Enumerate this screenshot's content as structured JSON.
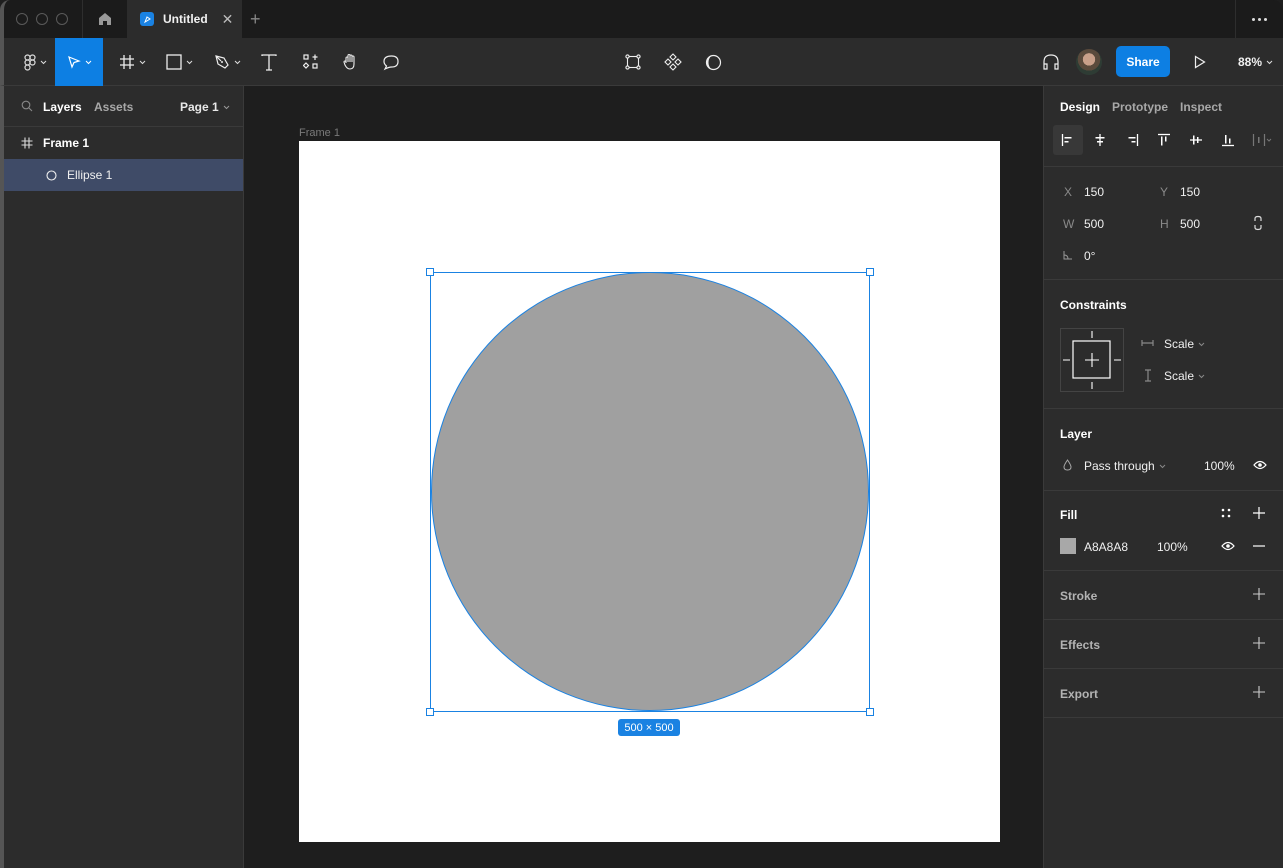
{
  "titlebar": {
    "tab_title": "Untitled",
    "home_icon": "home-icon",
    "close_icon": "close-icon",
    "add_tab_icon": "plus-icon",
    "more_icon": "more-icon"
  },
  "toolbar": {
    "tools": [
      {
        "name": "main-menu",
        "icon": "figma-logo-icon",
        "has_dropdown": true
      },
      {
        "name": "move-tool",
        "icon": "cursor-icon",
        "has_dropdown": true,
        "active": true
      },
      {
        "name": "frame-tool",
        "icon": "frame-icon",
        "has_dropdown": true
      },
      {
        "name": "shape-tool",
        "icon": "rectangle-icon",
        "has_dropdown": true
      },
      {
        "name": "pen-tool",
        "icon": "pen-icon",
        "has_dropdown": true
      },
      {
        "name": "text-tool",
        "icon": "text-icon"
      },
      {
        "name": "resources-tool",
        "icon": "resources-icon"
      },
      {
        "name": "hand-tool",
        "icon": "hand-icon"
      },
      {
        "name": "comment-tool",
        "icon": "comment-icon"
      }
    ],
    "center_tools": [
      {
        "name": "edit-object",
        "icon": "edit-object-icon"
      },
      {
        "name": "create-component",
        "icon": "component-icon"
      },
      {
        "name": "mask",
        "icon": "mask-icon"
      }
    ],
    "audio_icon": "headphones-icon",
    "share_label": "Share",
    "play_icon": "play-icon",
    "zoom_level": "88%"
  },
  "left_panel": {
    "tabs": [
      "Layers",
      "Assets"
    ],
    "active_tab": "Layers",
    "page_selector": "Page 1",
    "layers": [
      {
        "name": "Frame 1",
        "icon": "frame-icon",
        "selected": false
      },
      {
        "name": "Ellipse 1",
        "icon": "ellipse-icon",
        "selected": true
      }
    ]
  },
  "canvas": {
    "frame_label": "Frame 1",
    "selection_size": "500 × 500",
    "frame_color": "#FFFFFF",
    "ellipse_color": "#A0A0A0",
    "selection_color": "#1A82E2"
  },
  "right_panel": {
    "tabs": [
      "Design",
      "Prototype",
      "Inspect"
    ],
    "active_tab": "Design",
    "position": {
      "x_label": "X",
      "x": "150",
      "y_label": "Y",
      "y": "150",
      "w_label": "W",
      "w": "500",
      "h_label": "H",
      "h": "500",
      "rotation": "0°"
    },
    "constraints": {
      "title": "Constraints",
      "horizontal": "Scale",
      "vertical": "Scale"
    },
    "layer": {
      "title": "Layer",
      "blend_mode": "Pass through",
      "opacity": "100%"
    },
    "fill": {
      "title": "Fill",
      "hex": "A8A8A8",
      "opacity": "100%",
      "swatch_color": "#A8A8A8"
    },
    "stroke": {
      "title": "Stroke"
    },
    "effects": {
      "title": "Effects"
    },
    "export": {
      "title": "Export"
    }
  }
}
